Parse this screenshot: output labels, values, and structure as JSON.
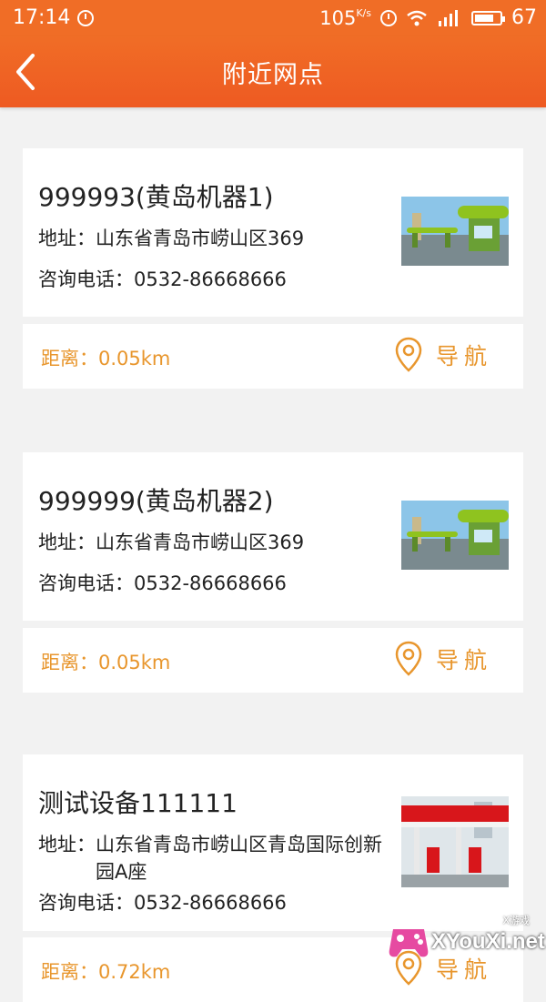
{
  "status_bar": {
    "time": "17:14",
    "net_speed": "105",
    "net_unit": "K/s",
    "battery": "67"
  },
  "header": {
    "title": "附近网点"
  },
  "labels": {
    "address": "地址：",
    "phone": "咨询电话："
  },
  "stations": [
    {
      "name": "999993(黄岛机器1)",
      "address": "山东省青岛市崂山区369",
      "phone": "0532-86668666",
      "distance": "距离：0.05km",
      "nav_label": "导航",
      "image": "green-kiosk-photo"
    },
    {
      "name": "999999(黄岛机器2)",
      "address": "山东省青岛市崂山区369",
      "phone": "0532-86668666",
      "distance": "距离：0.05km",
      "nav_label": "导航",
      "image": "green-kiosk-photo"
    },
    {
      "name": "测试设备111111",
      "address": "山东省青岛市崂山区青岛国际创新园A座",
      "phone": "0532-86668666",
      "distance": "距离：0.72km",
      "nav_label": "导航",
      "image": "gas-station-photo"
    }
  ],
  "watermark": {
    "text": "XYouXi.net",
    "tag": "X游戏"
  },
  "colors": {
    "header": "#f06d26",
    "accent": "#e8962d",
    "background": "#f2f2f2"
  }
}
